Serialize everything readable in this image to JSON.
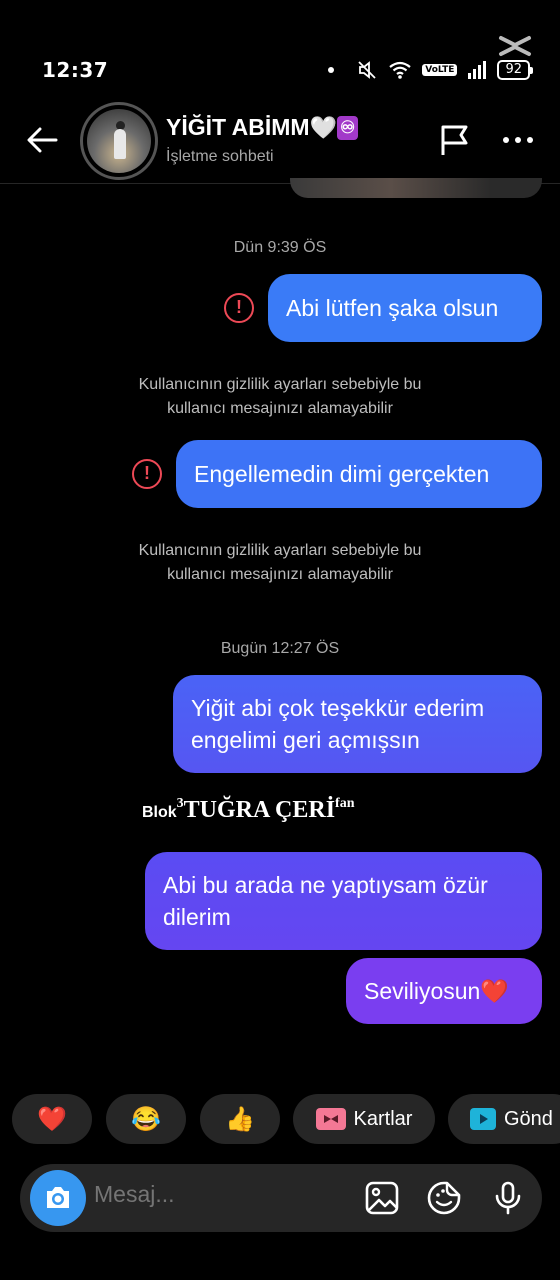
{
  "status_bar": {
    "time": "12:37",
    "network_badge": "VoLTE",
    "battery": "92"
  },
  "header": {
    "contact_name": "YİĞİT ABİMM",
    "name_emoji_heart": "🤍",
    "name_emoji_infinity": "♾",
    "subtitle": "İşletme sohbeti"
  },
  "messages": {
    "ts1": "Dün 9:39 ÖS",
    "m1": "Abi lütfen şaka olsun",
    "notice1": [
      "Kullanıcının gizlilik ayarları sebebiyle bu",
      "kullanıcı mesajınızı alamayabilir"
    ],
    "m2": "Engellemedin dimi gerçekten",
    "notice2": [
      "Kullanıcının gizlilik ayarları sebebiyle bu",
      "kullanıcı mesajınızı alamayabilir"
    ],
    "ts2": "Bugün 12:27 ÖS",
    "m3": [
      "Yiğit abi çok teşekkür ederim",
      "engelimi geri açmışsın"
    ],
    "m4": [
      "Abi bu arada ne yaptıysam özür",
      "dilerim"
    ],
    "m5": "Seviliyosun❤️",
    "error_icon_text": "!"
  },
  "watermark": {
    "part1": "Blok",
    "sup1": "3",
    "part2": "TUĞRA ÇERİ",
    "sup2": "fan"
  },
  "quick_replies": {
    "heart": "❤️",
    "laugh": "😂",
    "thumbs": "👍",
    "cards": "Kartlar",
    "send": "Gönd"
  },
  "composer": {
    "placeholder": "Mesaj..."
  },
  "colors": {
    "bubble_blue": "#3a7bf7",
    "bubble_purple": "#7f3df0",
    "error_red": "#ed4956",
    "camera_blue": "#3797f0"
  }
}
